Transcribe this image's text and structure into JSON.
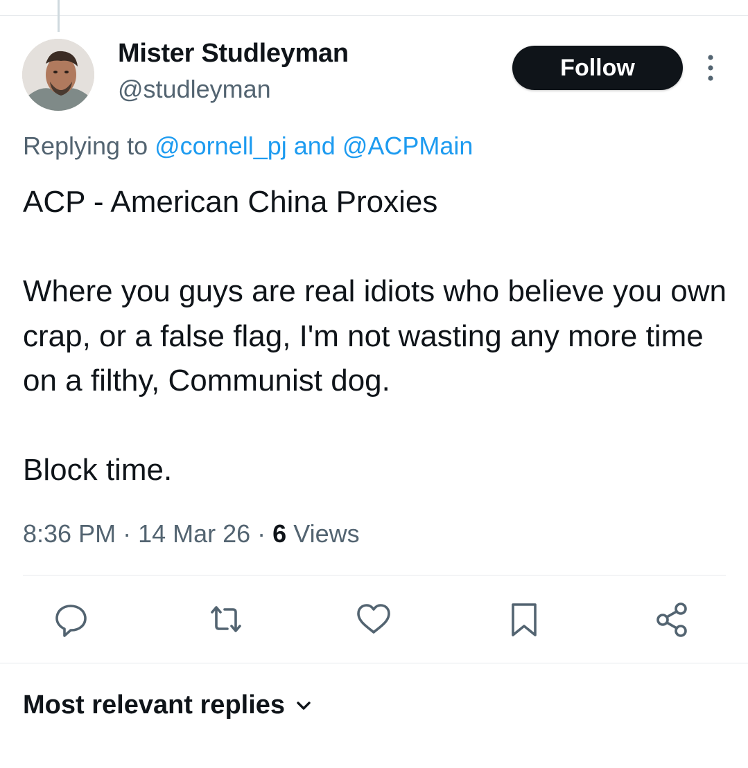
{
  "author": {
    "display_name": "Mister Studleyman",
    "handle": "@studleyman"
  },
  "follow_label": "Follow",
  "replying": {
    "prefix": "Replying to ",
    "mention1": "@cornell_pj",
    "joiner": " and ",
    "mention2": "@ACPMain"
  },
  "tweet_text": "ACP - American China Proxies\n\nWhere you guys are real idiots who believe you own crap, or a false flag, I'm not wasting any more time on a filthy, Communist dog.\n\nBlock time.",
  "meta": {
    "time": "8:36 PM",
    "sep1": " · ",
    "date": "14 Mar 26",
    "sep2": " · ",
    "views_count": "6",
    "views_label": " Views"
  },
  "actions": [
    "reply-icon",
    "retweet-icon",
    "like-icon",
    "bookmark-icon",
    "share-icon"
  ],
  "replies_sort_label": "Most relevant replies",
  "colors": {
    "accent": "#1d9bf0",
    "text": "#0f1419",
    "secondary": "#536471",
    "icon": "#536471",
    "divider": "#e6e9ec"
  }
}
